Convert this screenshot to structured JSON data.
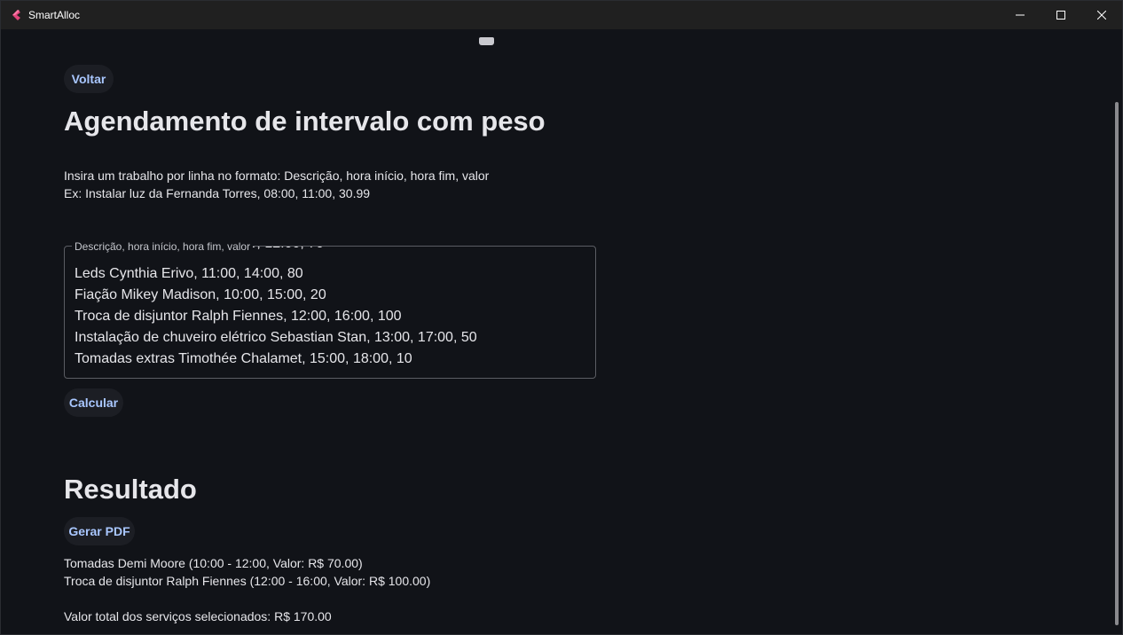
{
  "window": {
    "title": "SmartAlloc",
    "accent": "#a9c7ff",
    "background": "#111318"
  },
  "nav": {
    "back_label": "Voltar"
  },
  "page": {
    "title": "Agendamento de intervalo com peso",
    "instructions": [
      "Insira um trabalho por linha no formato: Descrição, hora início, hora fim, valor",
      "Ex: Instalar luz da Fernanda Torres, 08:00, 11:00, 30.99"
    ]
  },
  "input": {
    "label": "Descrição, hora início, hora fim, valor",
    "lines": [
      "Leds Cynthia Erivo, 11:00, 14:00, 80",
      "Fiação Mikey Madison, 10:00, 15:00, 20",
      "Troca de disjuntor Ralph Fiennes, 12:00, 16:00, 100",
      "Instalação de chuveiro elétrico Sebastian Stan, 13:00, 17:00, 50",
      "Tomadas extras Timothée Chalamet, 15:00, 18:00, 10"
    ]
  },
  "actions": {
    "calculate_label": "Calcular",
    "pdf_label": "Gerar PDF"
  },
  "result": {
    "title": "Resultado",
    "items": [
      "Tomadas Demi Moore (10:00 - 12:00, Valor: R$ 70.00)",
      "Troca de disjuntor Ralph Fiennes (12:00 - 16:00, Valor: R$ 100.00)"
    ],
    "total": "Valor total dos serviços selecionados: R$ 170.00"
  }
}
